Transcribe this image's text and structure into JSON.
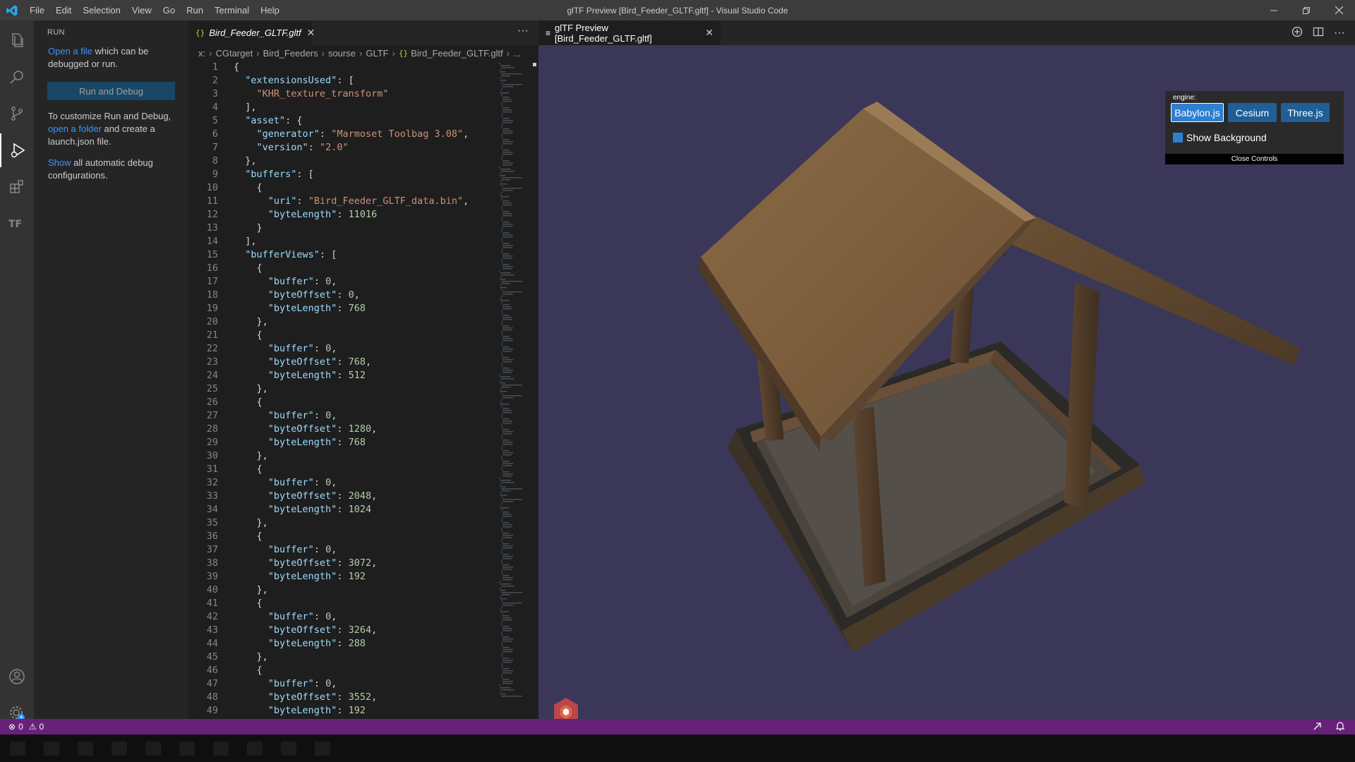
{
  "colors": {
    "status_bar": "#68217a",
    "viewport_bg": "#3a3758",
    "accent": "#0e639c",
    "engine_selected": "#2f7fd0"
  },
  "titlebar": {
    "logo_icon": "vscode-logo",
    "menu": [
      "File",
      "Edit",
      "Selection",
      "View",
      "Go",
      "Run",
      "Terminal",
      "Help"
    ],
    "title": "glTF Preview [Bird_Feeder_GLTF.gltf] - Visual Studio Code"
  },
  "activity_bar": [
    "explorer-icon",
    "search-icon",
    "source-control-icon",
    "run-debug-icon",
    "extensions-icon",
    "terraform-icon",
    "account-icon",
    "settings-gear-icon"
  ],
  "sidebar": {
    "header": "RUN",
    "open_file_link": "Open a file",
    "open_file_rest": " which can be debugged or run.",
    "run_button": "Run and Debug",
    "customize_text": "To customize Run and Debug,",
    "open_folder_link": "open a folder",
    "customize_rest": " and create a launch.json file.",
    "show_link": "Show",
    "show_rest": " all automatic debug configurations."
  },
  "editor1": {
    "tab_label": "Bird_Feeder_GLTF.gltf",
    "tab_icon": "{}",
    "more": "···",
    "breadcrumb": [
      "x:",
      "CGtarget",
      "Bird_Feeders",
      "sourse",
      "GLTF",
      "Bird_Feeder_GLTF.gltf",
      "..."
    ]
  },
  "code_lines": [
    "{",
    "  \"extensionsUsed\": [",
    "    \"KHR_texture_transform\"",
    "  ],",
    "  \"asset\": {",
    "    \"generator\": \"Marmoset Toolbag 3.08\",",
    "    \"version\": \"2.0\"",
    "  },",
    "  \"buffers\": [",
    "    {",
    "      \"uri\": \"Bird_Feeder_GLTF_data.bin\",",
    "      \"byteLength\": 11016",
    "    }",
    "  ],",
    "  \"bufferViews\": [",
    "    {",
    "      \"buffer\": 0,",
    "      \"byteOffset\": 0,",
    "      \"byteLength\": 768",
    "    },",
    "    {",
    "      \"buffer\": 0,",
    "      \"byteOffset\": 768,",
    "      \"byteLength\": 512",
    "    },",
    "    {",
    "      \"buffer\": 0,",
    "      \"byteOffset\": 1280,",
    "      \"byteLength\": 768",
    "    },",
    "    {",
    "      \"buffer\": 0,",
    "      \"byteOffset\": 2048,",
    "      \"byteLength\": 1024",
    "    },",
    "    {",
    "      \"buffer\": 0,",
    "      \"byteOffset\": 3072,",
    "      \"byteLength\": 192",
    "    },",
    "    {",
    "      \"buffer\": 0,",
    "      \"byteOffset\": 3264,",
    "      \"byteLength\": 288",
    "    },",
    "    {",
    "      \"buffer\": 0,",
    "      \"byteOffset\": 3552,",
    "      \"byteLength\": 192"
  ],
  "editor2": {
    "tab_label": "glTF Preview [Bird_Feeder_GLTF.gltf]",
    "tab_icons": [
      "preview-lines-icon"
    ],
    "toolbar_icons": [
      "gltf-icon",
      "split-editor-icon",
      "more-actions-icon"
    ],
    "more": "···"
  },
  "controls": {
    "engine_label": "engine:",
    "engines": [
      "Babylon.js",
      "Cesium",
      "Three.js"
    ],
    "selected_engine": "Babylon.js",
    "show_background_label": "Show Background",
    "show_background_checked": true,
    "close_label": "Close Controls"
  },
  "statusbar": {
    "errors": "0",
    "warnings": "0"
  }
}
